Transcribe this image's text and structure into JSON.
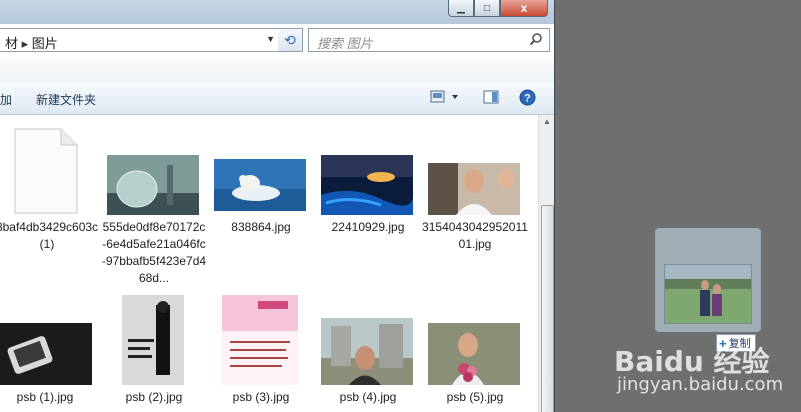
{
  "window": {
    "controls": {
      "minimize": "▁",
      "maximize": "□",
      "close": "x"
    }
  },
  "address": {
    "crumb_prev": "材",
    "crumb_sep": "▸",
    "crumb_current": "图片"
  },
  "search": {
    "placeholder": "搜索 图片"
  },
  "toolbar": {
    "left_partial": "加",
    "new_folder": "新建文件夹"
  },
  "files": [
    {
      "name": "8baf4db3429c603c (1)",
      "kind": "blank-document"
    },
    {
      "name": "555de0df8e70172c-6e4d5afe21a046fc-97bbafb5f423e7d468d...",
      "kind": "fishbowl-photo"
    },
    {
      "name": "838864.jpg",
      "kind": "polar-bear-photo"
    },
    {
      "name": "22410929.jpg",
      "kind": "night-beach-photo"
    },
    {
      "name": "315404304295201101.jpg",
      "kind": "people-photo"
    },
    {
      "name": "psb (1).jpg",
      "kind": "dark-product-photo"
    },
    {
      "name": "psb (2).jpg",
      "kind": "poster-photo"
    },
    {
      "name": "psb (3).jpg",
      "kind": "pink-flyer-photo"
    },
    {
      "name": "psb (4).jpg",
      "kind": "outdoor-portrait-photo"
    },
    {
      "name": "psb (5).jpg",
      "kind": "flowers-portrait-photo"
    }
  ],
  "drag": {
    "copy_label": "复制"
  },
  "watermark": {
    "brand": "Baidu 经验",
    "url": "jingyan.baidu.com"
  },
  "colors": {
    "accent": "#2b6fc7",
    "toolbar_text": "#1e395b",
    "close_red": "#c94a34"
  }
}
